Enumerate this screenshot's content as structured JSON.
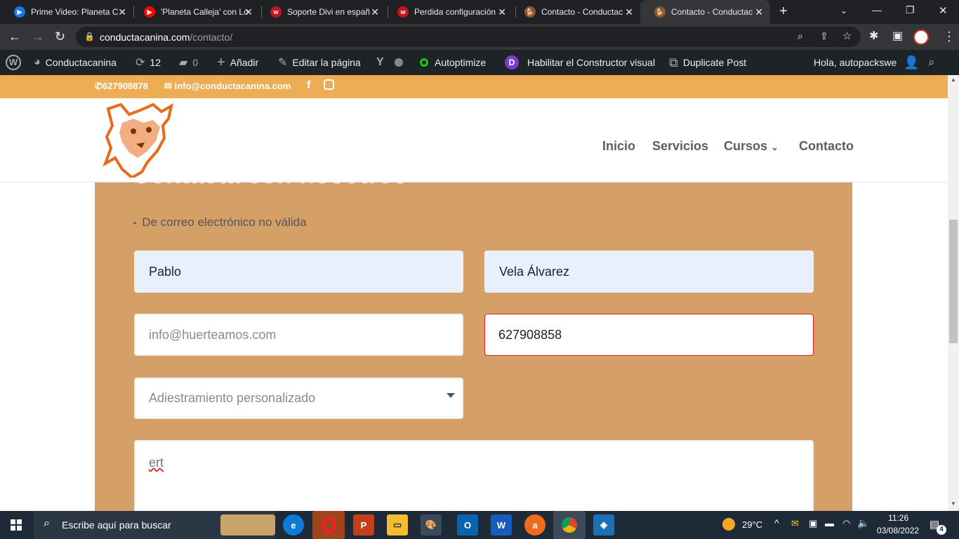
{
  "browser": {
    "tabs": [
      {
        "title": "Prime Video: Planeta C",
        "icon": "prime-video-icon",
        "color": "#1a73e8"
      },
      {
        "title": "'Planeta Calleja' con Lo",
        "icon": "youtube-icon",
        "color": "#ff0000"
      },
      {
        "title": "Soporte Divi en españ",
        "icon": "wpmudev-icon",
        "color": "#c4161c"
      },
      {
        "title": "Perdida configuración",
        "icon": "wpmudev-icon",
        "color": "#c4161c"
      },
      {
        "title": "Contacto - Conductac",
        "icon": "dog-favicon",
        "color": "#8b5a2b"
      },
      {
        "title": "Contacto - Conductac",
        "icon": "dog-favicon",
        "color": "#8b5a2b"
      }
    ],
    "new_tab": "+",
    "url_host": "conductacanina.com",
    "url_path": "/contacto/"
  },
  "adminbar": {
    "site": "Conductacanina",
    "updates": "12",
    "comments": "0",
    "add_new": "Añadir",
    "edit_page": "Editar la página",
    "autoptimize": "Autoptimize",
    "visual_builder": "Habilitar el Constructor visual",
    "duplicate_post": "Duplicate Post",
    "greeting": "Hola, autopackswe"
  },
  "topbar": {
    "phone": "627908878",
    "email": "info@conductacanina.com"
  },
  "menu": {
    "items": [
      "Inicio",
      "Servicios",
      "Cursos",
      "Contacto"
    ]
  },
  "form": {
    "heading": "Contacta con nosotros",
    "error": "De correo electrónico no válida",
    "first_name": "Pablo",
    "last_name": "Vela Álvarez",
    "email_placeholder": "info@huerteamos.com",
    "phone": "627908858",
    "service_placeholder": "Adiestramiento personalizado",
    "message": "ert"
  },
  "taskbar": {
    "search_placeholder": "Escribe aquí para buscar",
    "temperature": "29°C",
    "time": "11:26",
    "date": "03/08/2022",
    "notifications": "4"
  },
  "colors": {
    "topbar": "#edad55",
    "form_bg": "#d4a068",
    "invalid_border": "#e31c1c",
    "autofill": "#e8f0fe"
  }
}
